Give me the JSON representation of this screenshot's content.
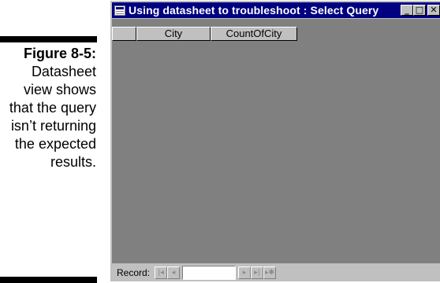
{
  "caption": {
    "figure_label": "Figure 8-5:",
    "text": "Datasheet view shows that the query isn’t returning the expected results."
  },
  "window": {
    "title": "Using datasheet to troubleshoot : Select Query",
    "controls": {
      "minimize": "_",
      "maximize": "□",
      "close": "✕"
    }
  },
  "datasheet": {
    "columns": [
      "City",
      "CountOfCity"
    ],
    "rows": []
  },
  "statusbar": {
    "record_label": "Record:",
    "record_value": "",
    "nav": {
      "first": "|◂",
      "prev": "◂",
      "next": "▸",
      "last": "▸|",
      "new": "▸✱"
    }
  }
}
